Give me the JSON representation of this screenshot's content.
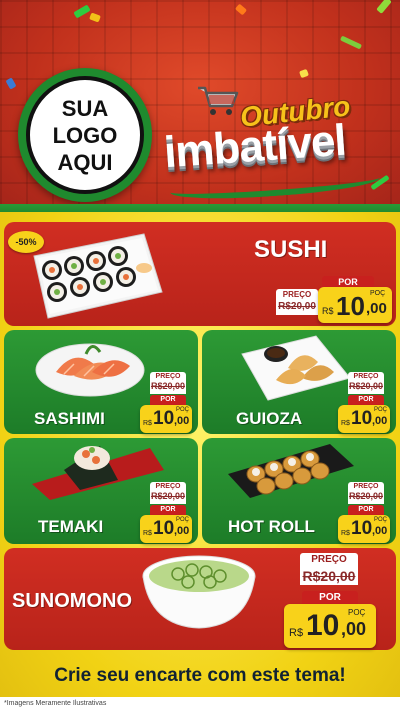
{
  "logo": {
    "line1": "SUA",
    "line2": "LOGO",
    "line3": "AQUI"
  },
  "promo": {
    "word1": "Outubro",
    "word2": "imbatível"
  },
  "featured": {
    "name": "SUSHI",
    "discount": "-50%",
    "preco_label": "PREÇO",
    "old_price": "R$20,00",
    "por_label": "POR",
    "currency": "R$",
    "price_int": "10",
    "price_dec": ",00",
    "unit": "POÇ"
  },
  "items": [
    {
      "name": "SASHIMI",
      "preco_label": "PREÇO",
      "old_price": "R$20,00",
      "por_label": "POR",
      "currency": "R$",
      "price_int": "10",
      "price_dec": ",00",
      "unit": "POÇ"
    },
    {
      "name": "GUIOZA",
      "preco_label": "PREÇO",
      "old_price": "R$20,00",
      "por_label": "POR",
      "currency": "R$",
      "price_int": "10",
      "price_dec": ",00",
      "unit": "POÇ"
    },
    {
      "name": "TEMAKI",
      "preco_label": "PREÇO",
      "old_price": "R$20,00",
      "por_label": "POR",
      "currency": "R$",
      "price_int": "10",
      "price_dec": ",00",
      "unit": "POÇ"
    },
    {
      "name": "HOT ROLL",
      "preco_label": "PREÇO",
      "old_price": "R$20,00",
      "por_label": "POR",
      "currency": "R$",
      "price_int": "10",
      "price_dec": ",00",
      "unit": "POÇ"
    }
  ],
  "bottom": {
    "name": "SUNOMONO",
    "preco_label": "PREÇO",
    "old_price": "R$20,00",
    "por_label": "POR",
    "currency": "R$",
    "price_int": "10",
    "price_dec": ",00",
    "unit": "POÇ"
  },
  "banner": "Crie seu encarte com este tema!",
  "disclaimer": "*Imagens Meramente Ilustrativas",
  "colors": {
    "red": "#c8201e",
    "green": "#1f8a2e",
    "yellow": "#f8d21a"
  }
}
